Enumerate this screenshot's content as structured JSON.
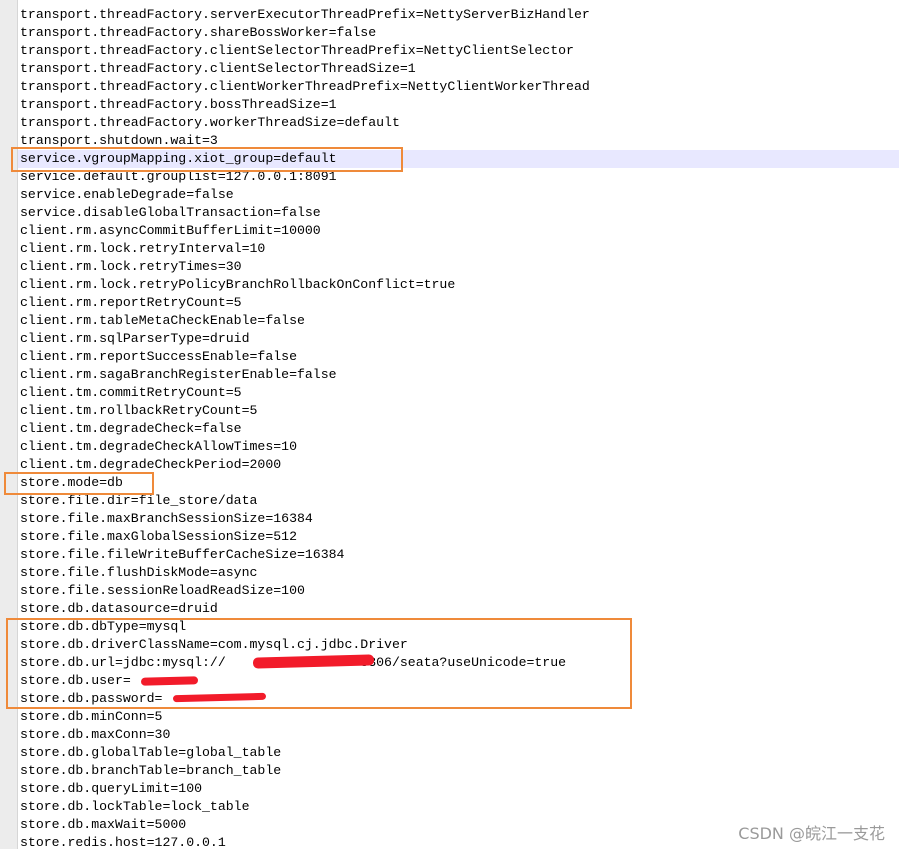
{
  "editor": {
    "lines": [
      "transport.threadFactory.serverExecutorThreadPrefix=NettyServerBizHandler",
      "transport.threadFactory.shareBossWorker=false",
      "transport.threadFactory.clientSelectorThreadPrefix=NettyClientSelector",
      "transport.threadFactory.clientSelectorThreadSize=1",
      "transport.threadFactory.clientWorkerThreadPrefix=NettyClientWorkerThread",
      "transport.threadFactory.bossThreadSize=1",
      "transport.threadFactory.workerThreadSize=default",
      "transport.shutdown.wait=3",
      "service.vgroupMapping.xiot_group=default",
      "service.default.grouplist=127.0.0.1:8091",
      "service.enableDegrade=false",
      "service.disableGlobalTransaction=false",
      "client.rm.asyncCommitBufferLimit=10000",
      "client.rm.lock.retryInterval=10",
      "client.rm.lock.retryTimes=30",
      "client.rm.lock.retryPolicyBranchRollbackOnConflict=true",
      "client.rm.reportRetryCount=5",
      "client.rm.tableMetaCheckEnable=false",
      "client.rm.sqlParserType=druid",
      "client.rm.reportSuccessEnable=false",
      "client.rm.sagaBranchRegisterEnable=false",
      "client.tm.commitRetryCount=5",
      "client.tm.rollbackRetryCount=5",
      "client.tm.degradeCheck=false",
      "client.tm.degradeCheckAllowTimes=10",
      "client.tm.degradeCheckPeriod=2000",
      "store.mode=db",
      "store.file.dir=file_store/data",
      "store.file.maxBranchSessionSize=16384",
      "store.file.maxGlobalSessionSize=512",
      "store.file.fileWriteBufferCacheSize=16384",
      "store.file.flushDiskMode=async",
      "store.file.sessionReloadReadSize=100",
      "store.db.datasource=druid",
      "store.db.dbType=mysql",
      "store.db.driverClassName=com.mysql.cj.jdbc.Driver",
      "store.db.url=jdbc:mysql://                 3306/seata?useUnicode=true",
      "store.db.user=",
      "store.db.password=",
      "store.db.minConn=5",
      "store.db.maxConn=30",
      "store.db.globalTable=global_table",
      "store.db.branchTable=branch_table",
      "store.db.queryLimit=100",
      "store.db.lockTable=lock_table",
      "store.db.maxWait=5000",
      "store.redis.host=127.0.0.1"
    ]
  },
  "watermark": {
    "text": "CSDN @皖江一支花"
  },
  "colors": {
    "highlight_border": "#ef8a3a",
    "redaction": "#f21b2a",
    "current_line": "#e8e8ff"
  }
}
